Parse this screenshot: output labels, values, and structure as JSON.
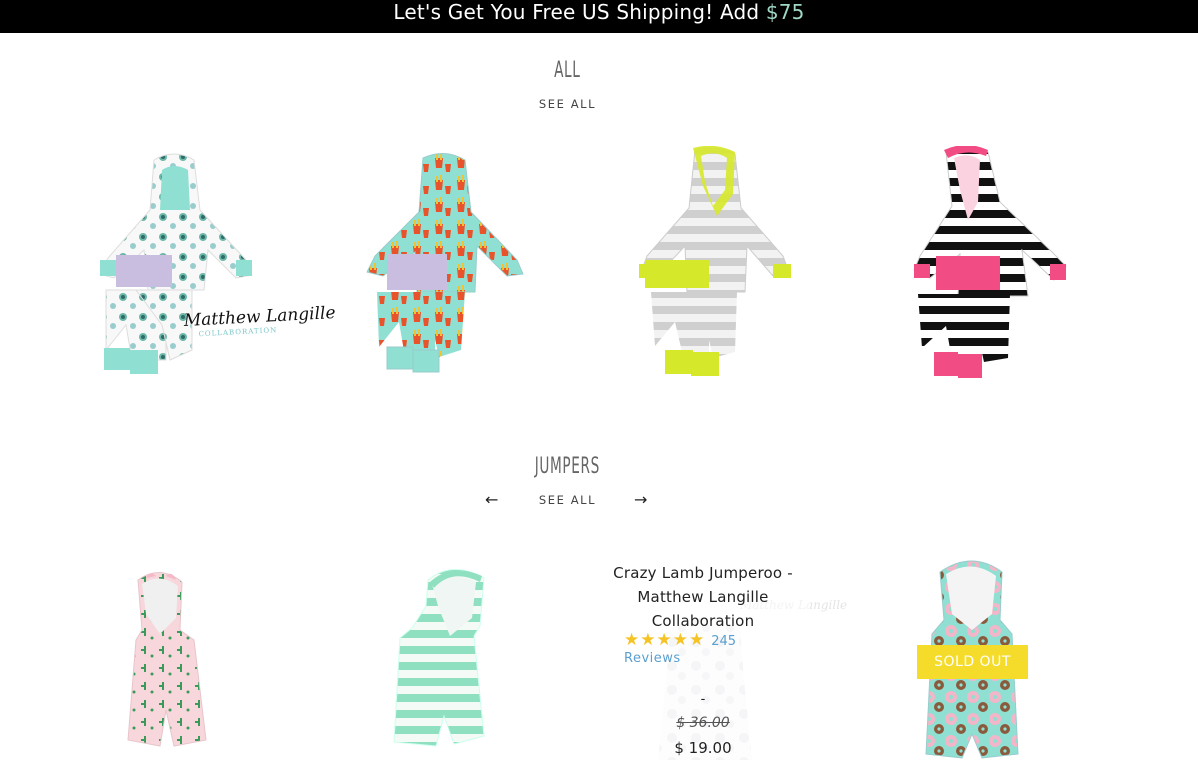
{
  "announcement": {
    "text": "Let's Get You Free US Shipping! Add ",
    "amount": "$75"
  },
  "sections": [
    {
      "title": "ALL",
      "see_all": "SEE ALL"
    },
    {
      "title": "JUMPERS",
      "see_all": "SEE ALL",
      "prev_arrow": "←",
      "next_arrow": "→"
    }
  ],
  "signature": {
    "name": "Matthew Langille",
    "sub": "COLLABORATION"
  },
  "hover_product": {
    "title": "Crazy Lamb Jumperoo - Matthew Langille Collaboration",
    "stars": "★★★★★",
    "rating": 5,
    "review_count": "245",
    "reviews_label": "Reviews",
    "dash": "-",
    "compare_price": "$ 36.00",
    "price": "$ 19.00"
  },
  "sold_out": "SOLD OUT",
  "colors": {
    "mint": "#8fe0d2",
    "lime": "#d6e82a",
    "pink": "#f24c84",
    "lavender": "#c9bde0",
    "star": "#f5c324",
    "link_blue": "#5a9fcf",
    "badge": "#f5dc2a"
  }
}
